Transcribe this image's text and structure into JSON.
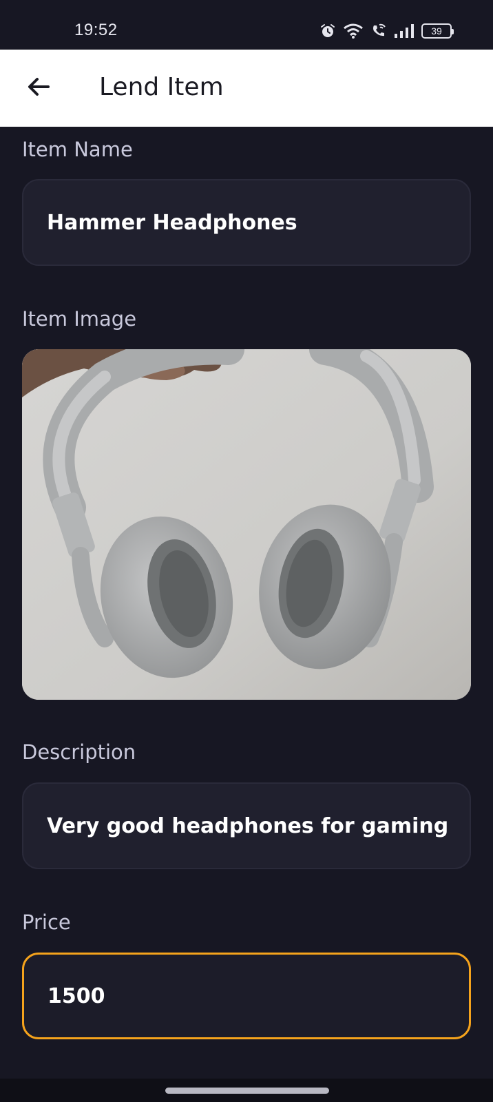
{
  "status_bar": {
    "time": "19:52",
    "battery": "39",
    "icons": [
      "alarm-icon",
      "wifi-icon",
      "wifi-call-icon",
      "signal-icon",
      "battery-icon"
    ]
  },
  "app_bar": {
    "title": "Lend Item",
    "back_icon": "arrow-left-icon"
  },
  "form": {
    "item_name": {
      "label": "Item Name",
      "value": "Hammer Headphones"
    },
    "item_image": {
      "label": "Item Image"
    },
    "description": {
      "label": "Description",
      "value": "Very good headphones for gaming"
    },
    "price": {
      "label": "Price",
      "value": "1500"
    }
  },
  "colors": {
    "background": "#171723",
    "field_bg": "#20202e",
    "accent_focus": "#f5a31c",
    "label": "#c9c9dc"
  }
}
